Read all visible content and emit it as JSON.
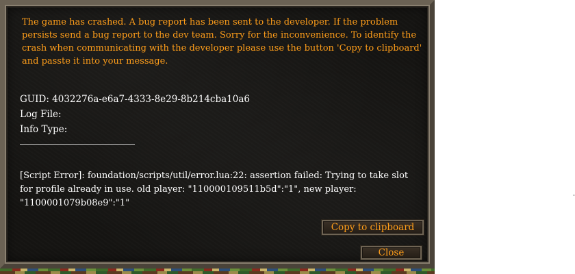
{
  "dialog": {
    "message": "The game has crashed. A bug report has been sent to the developer. If the problem persists send a bug report to the dev team. Sorry for the inconvenience. To identify the crash when communicating with the developer please use the button 'Copy to clipboard' and passte it into your message.",
    "guid_line": "GUID: 4032276a-e6a7-4333-8e29-8b214cba10a6",
    "log_file_line": "Log File:",
    "info_type_line": "Info Type:",
    "error_text": "[Script Error]:  foundation/scripts/util/error.lua:22: assertion failed: Trying to take slot for profile already in use. old player: \"110000109511b5d\":\"1\", new player: \"1100001079b08e9\":\"1\"",
    "copy_button_label": "Copy to clipboard",
    "close_button_label": "Close"
  },
  "colors": {
    "message_text": "#ff9e1a",
    "body_text": "#ffffff",
    "dialog_background": "#151412",
    "frame": "#5c5448"
  }
}
